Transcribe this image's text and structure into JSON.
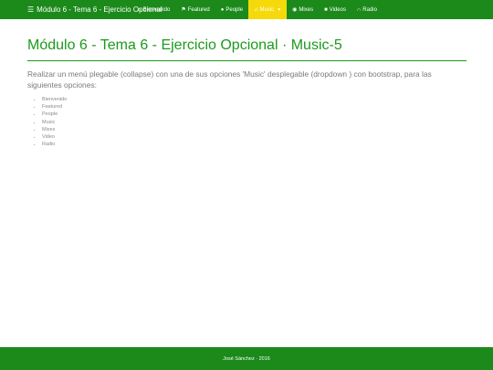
{
  "brand": {
    "label": "Módulo 6 - Tema 6 - Ejercicio Opcional",
    "icon": "graduation-cap-icon"
  },
  "nav": [
    {
      "label": "Bienvenido",
      "icon": "home-icon"
    },
    {
      "label": "Featured",
      "icon": "flag-icon"
    },
    {
      "label": "People",
      "icon": "user-icon"
    },
    {
      "label": "Music",
      "icon": "music-icon",
      "active": true,
      "dropdown": true
    },
    {
      "label": "Mixes",
      "icon": "globe-icon"
    },
    {
      "label": "Videos",
      "icon": "video-icon"
    },
    {
      "label": "Radio",
      "icon": "headphones-icon"
    }
  ],
  "colors": {
    "navbar": "#1b8a1b",
    "active": "#f5d90a",
    "title": "#1c9a1c"
  },
  "main": {
    "title": "Módulo 6 - Tema 6 - Ejercicio Opcional · Music-5",
    "description": "Realizar un menú plegable (collapse) con una de sus opciones 'Music' desplegable (dropdown ) con bootstrap, para las siguientes opciones:",
    "options": [
      "Bienvenido",
      "Featured",
      "People",
      "Music",
      "Mixes",
      "Video",
      "Radio"
    ]
  },
  "footer": {
    "text": "José Sánchez · 2016"
  }
}
